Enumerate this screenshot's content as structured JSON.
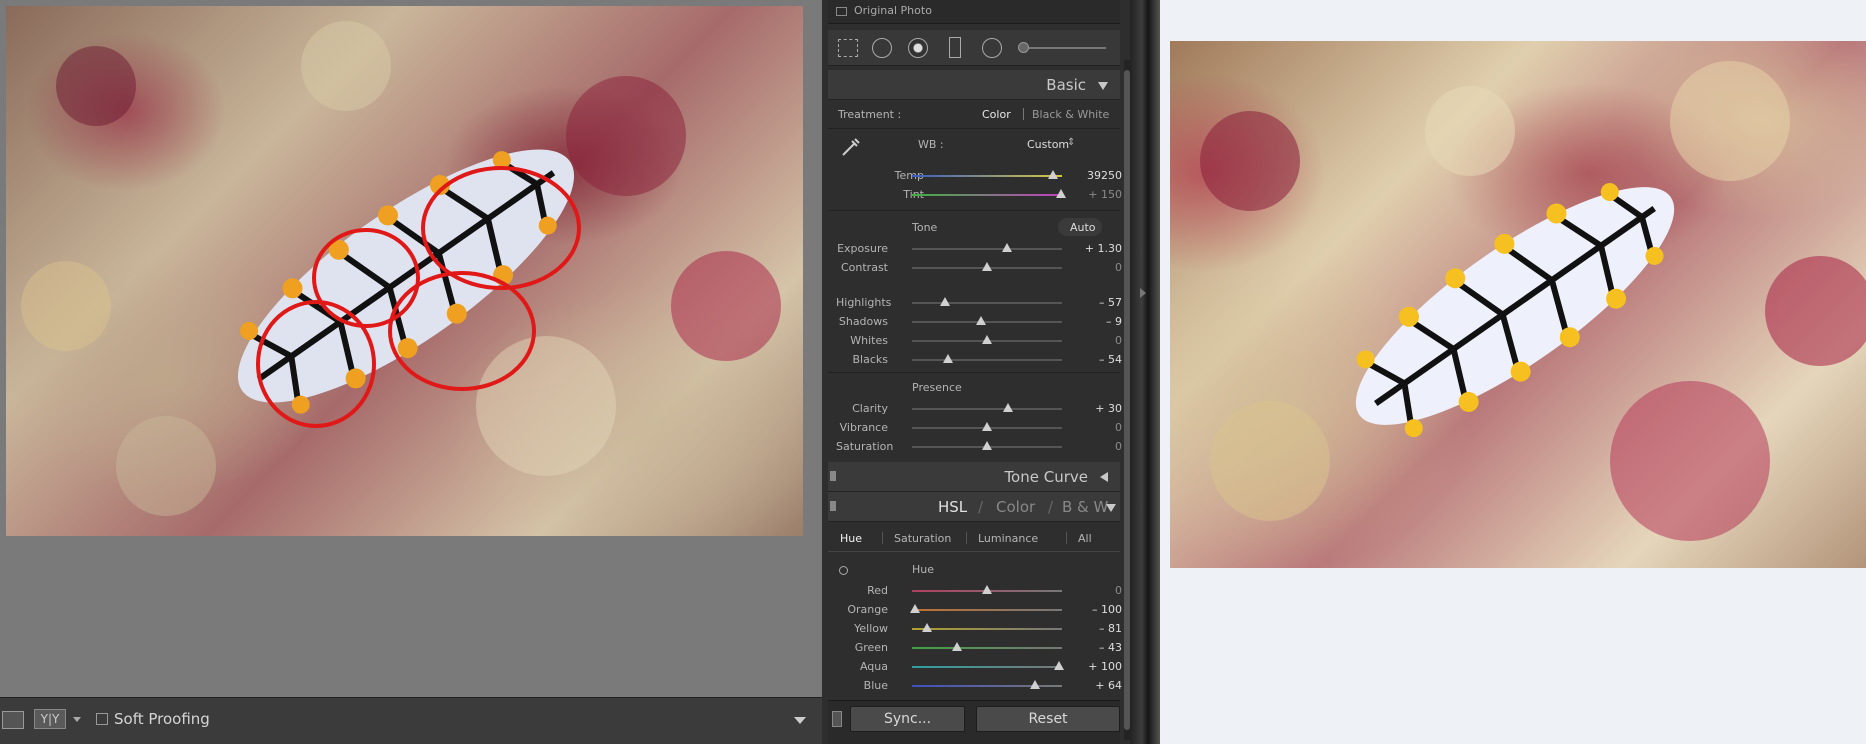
{
  "viewer": {
    "soft_proofing_label": "Soft Proofing",
    "view_mode_label": "Y|Y"
  },
  "panel": {
    "original_photo_label": "Original Photo",
    "basic": {
      "title": "Basic",
      "treatment_label": "Treatment :",
      "treatment_color": "Color",
      "treatment_bw": "Black & White",
      "wb_label": "WB :",
      "wb_value": "Custom",
      "temp": {
        "label": "Temp",
        "value": "39250",
        "position": 0.93
      },
      "tint": {
        "label": "Tint",
        "value": "+ 150",
        "position": 0.98
      },
      "tone_label": "Tone",
      "auto_label": "Auto",
      "tone_sliders": [
        {
          "label": "Exposure",
          "value": "+ 1.30",
          "position": 0.63
        },
        {
          "label": "Contrast",
          "value": "0",
          "position": 0.5
        }
      ],
      "tone_sliders_2": [
        {
          "label": "Highlights",
          "value": "– 57",
          "position": 0.22
        },
        {
          "label": "Shadows",
          "value": "– 9",
          "position": 0.46
        },
        {
          "label": "Whites",
          "value": "0",
          "position": 0.5
        },
        {
          "label": "Blacks",
          "value": "– 54",
          "position": 0.24
        }
      ],
      "presence_label": "Presence",
      "presence_sliders": [
        {
          "label": "Clarity",
          "value": "+ 30",
          "position": 0.64
        },
        {
          "label": "Vibrance",
          "value": "0",
          "position": 0.5
        },
        {
          "label": "Saturation",
          "value": "0",
          "position": 0.5
        }
      ]
    },
    "tone_curve_title": "Tone Curve",
    "hsl": {
      "title_hsl": "HSL",
      "title_color": "Color",
      "title_bw": "B & W",
      "slash": "/",
      "tabs": [
        "Hue",
        "Saturation",
        "Luminance",
        "All"
      ],
      "section_label": "Hue",
      "sliders": [
        {
          "label": "Red",
          "value": "0",
          "position": 0.5,
          "color": "#b04060"
        },
        {
          "label": "Orange",
          "value": "– 100",
          "position": 0.02,
          "color": "#c07030"
        },
        {
          "label": "Yellow",
          "value": "– 81",
          "position": 0.1,
          "color": "#b0a030"
        },
        {
          "label": "Green",
          "value": "– 43",
          "position": 0.3,
          "color": "#40a040"
        },
        {
          "label": "Aqua",
          "value": "+ 100",
          "position": 0.98,
          "color": "#30a0a0"
        },
        {
          "label": "Blue",
          "value": "+ 64",
          "position": 0.82,
          "color": "#4050c0"
        }
      ]
    },
    "sync_label": "Sync...",
    "reset_label": "Reset"
  },
  "colors": {
    "annotation_red": "#e01818",
    "nudibranch_body": "#dfe3f0",
    "nudibranch_spots": "#f0a020"
  }
}
